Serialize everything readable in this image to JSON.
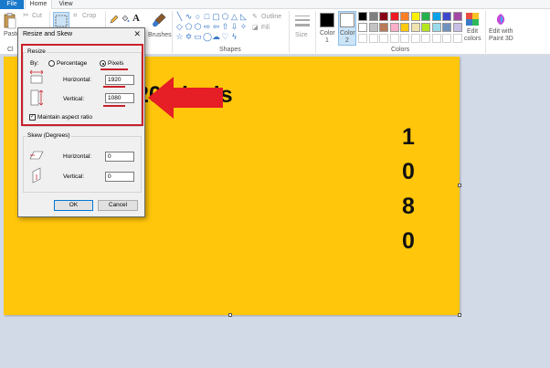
{
  "menu": {
    "file": "File",
    "home": "Home",
    "view": "View"
  },
  "ribbon": {
    "clipboard": {
      "paste": "Paste",
      "cut": "Cut",
      "crop": "Crop",
      "clip_partial": "Cl"
    },
    "tools": {
      "brushes": "Brushes"
    },
    "shapes": {
      "outline": "Outline",
      "fill": "Fill",
      "group_label": "Shapes"
    },
    "size": "Size",
    "color1": {
      "line1": "Color",
      "line2": "1"
    },
    "color2": {
      "line1": "Color",
      "line2": "2"
    },
    "colors_group_label": "Colors",
    "edit_colors": {
      "line1": "Edit",
      "line2": "colors"
    },
    "edit_paint3d": {
      "line1": "Edit with",
      "line2": "Paint 3D"
    },
    "palette_row1": [
      "#000000",
      "#7f7f7f",
      "#880015",
      "#ed1c24",
      "#ff7f27",
      "#fff200",
      "#22b14c",
      "#00a2e8",
      "#3f48cc",
      "#a349a4"
    ],
    "palette_row2": [
      "#ffffff",
      "#c3c3c3",
      "#b97a57",
      "#ffaec9",
      "#ffc90e",
      "#efe4b0",
      "#b5e61d",
      "#99d9ea",
      "#7092be",
      "#c8bfe7"
    ],
    "palette_row3": [
      "#ffffff",
      "#ffffff",
      "#ffffff",
      "#ffffff",
      "#ffffff",
      "#ffffff",
      "#ffffff",
      "#ffffff",
      "#ffffff",
      "#ffffff"
    ]
  },
  "canvas": {
    "background": "#ffc60b",
    "title_partial": "20 pixels",
    "vertical_digits": [
      "1",
      "0",
      "8",
      "0"
    ]
  },
  "dialog": {
    "title": "Resize and Skew",
    "close": "✕",
    "resize": {
      "legend": "Resize",
      "by_label": "By:",
      "percentage_label": "Percentage",
      "pixels_label": "Pixels",
      "selected": "pixels",
      "horizontal_label": "Horizontal:",
      "horizontal_value": "1920",
      "vertical_label": "Vertical:",
      "vertical_value": "1080",
      "maintain_label": "Maintain aspect ratio",
      "maintain_checked": true
    },
    "skew": {
      "legend": "Skew (Degrees)",
      "horizontal_label": "Horizontal:",
      "horizontal_value": "0",
      "vertical_label": "Vertical:",
      "vertical_value": "0"
    },
    "ok_label": "OK",
    "cancel_label": "Cancel"
  },
  "annotation": {
    "highlight_color": "#c8202a"
  }
}
